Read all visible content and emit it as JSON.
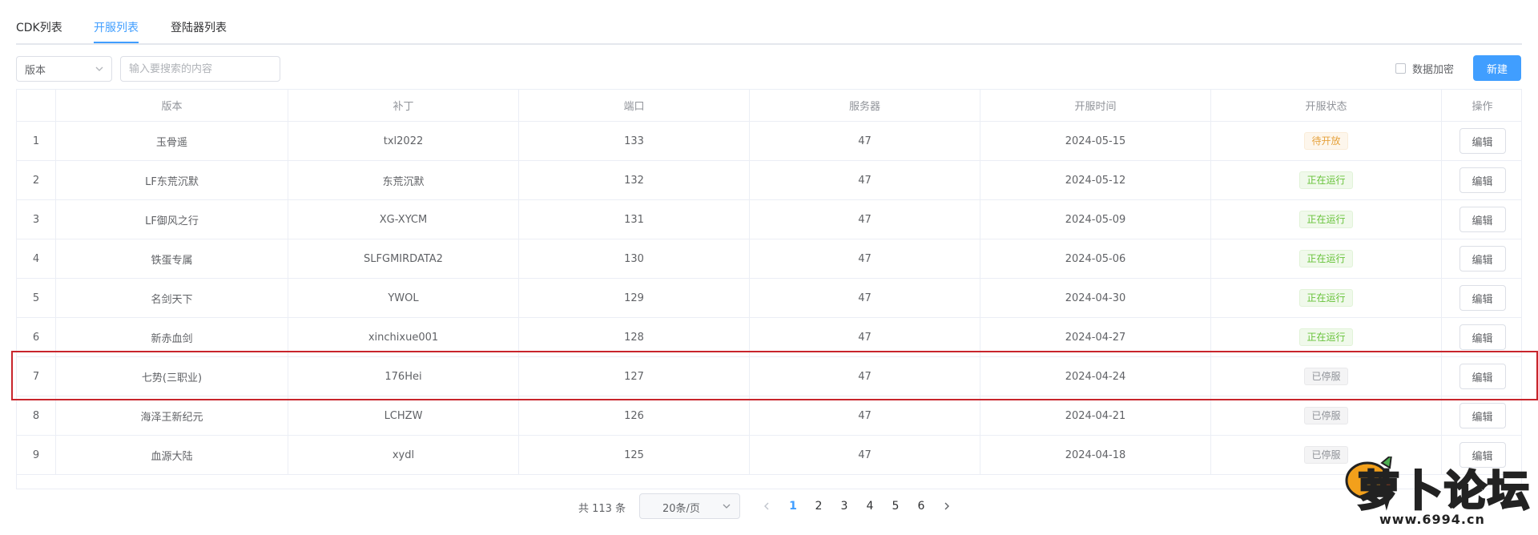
{
  "tabs": [
    {
      "label": "CDK列表",
      "active": false
    },
    {
      "label": "开服列表",
      "active": true
    },
    {
      "label": "登陆器列表",
      "active": false
    }
  ],
  "toolbar": {
    "version_select": "版本",
    "search_placeholder": "输入要搜索的内容",
    "encrypt_label": "数据加密",
    "new_label": "新建"
  },
  "table": {
    "headers": [
      "",
      "版本",
      "补丁",
      "端口",
      "服务器",
      "开服时间",
      "开服状态",
      "操作"
    ],
    "edit_label": "编辑",
    "rows": [
      {
        "index": "1",
        "version": "玉骨遥",
        "patch": "txl2022",
        "port": "133",
        "server": "47",
        "date": "2024-05-15",
        "status": "待开放",
        "status_type": "pending"
      },
      {
        "index": "2",
        "version": "LF东荒沉默",
        "patch": "东荒沉默",
        "port": "132",
        "server": "47",
        "date": "2024-05-12",
        "status": "正在运行",
        "status_type": "running"
      },
      {
        "index": "3",
        "version": "LF御风之行",
        "patch": "XG-XYCM",
        "port": "131",
        "server": "47",
        "date": "2024-05-09",
        "status": "正在运行",
        "status_type": "running"
      },
      {
        "index": "4",
        "version": "铁蛋专属",
        "patch": "SLFGMIRDATA2",
        "port": "130",
        "server": "47",
        "date": "2024-05-06",
        "status": "正在运行",
        "status_type": "running"
      },
      {
        "index": "5",
        "version": "名剑天下",
        "patch": "YWOL",
        "port": "129",
        "server": "47",
        "date": "2024-04-30",
        "status": "正在运行",
        "status_type": "running"
      },
      {
        "index": "6",
        "version": "新赤血剑",
        "patch": "xinchixue001",
        "port": "128",
        "server": "47",
        "date": "2024-04-27",
        "status": "正在运行",
        "status_type": "running"
      },
      {
        "index": "7",
        "version": "七势(三职业)",
        "patch": "176Hei",
        "port": "127",
        "server": "47",
        "date": "2024-04-24",
        "status": "已停服",
        "status_type": "stopped"
      },
      {
        "index": "8",
        "version": "海泽王新纪元",
        "patch": "LCHZW",
        "port": "126",
        "server": "47",
        "date": "2024-04-21",
        "status": "已停服",
        "status_type": "stopped"
      },
      {
        "index": "9",
        "version": "血源大陆",
        "patch": "xydl",
        "port": "125",
        "server": "47",
        "date": "2024-04-18",
        "status": "已停服",
        "status_type": "stopped"
      }
    ]
  },
  "status_colors": {
    "pending": {
      "color": "#e6a23c",
      "bg": "#fdf6ec",
      "border": "#faecd8"
    },
    "running": {
      "color": "#67c23a",
      "bg": "#f0f9eb",
      "border": "#e1f3d8"
    },
    "stopped": {
      "color": "#909399",
      "bg": "#f4f4f5",
      "border": "#e9e9eb"
    }
  },
  "pagination": {
    "total": "共 113 条",
    "page_size": "20条/页",
    "pages": [
      "1",
      "2",
      "3",
      "4",
      "5",
      "6"
    ],
    "current": "1"
  },
  "accent_color": "#409eff",
  "highlight_color": "#c8252c",
  "watermark": {
    "logo": "萝卜论坛",
    "url": "www.6994.cn"
  }
}
